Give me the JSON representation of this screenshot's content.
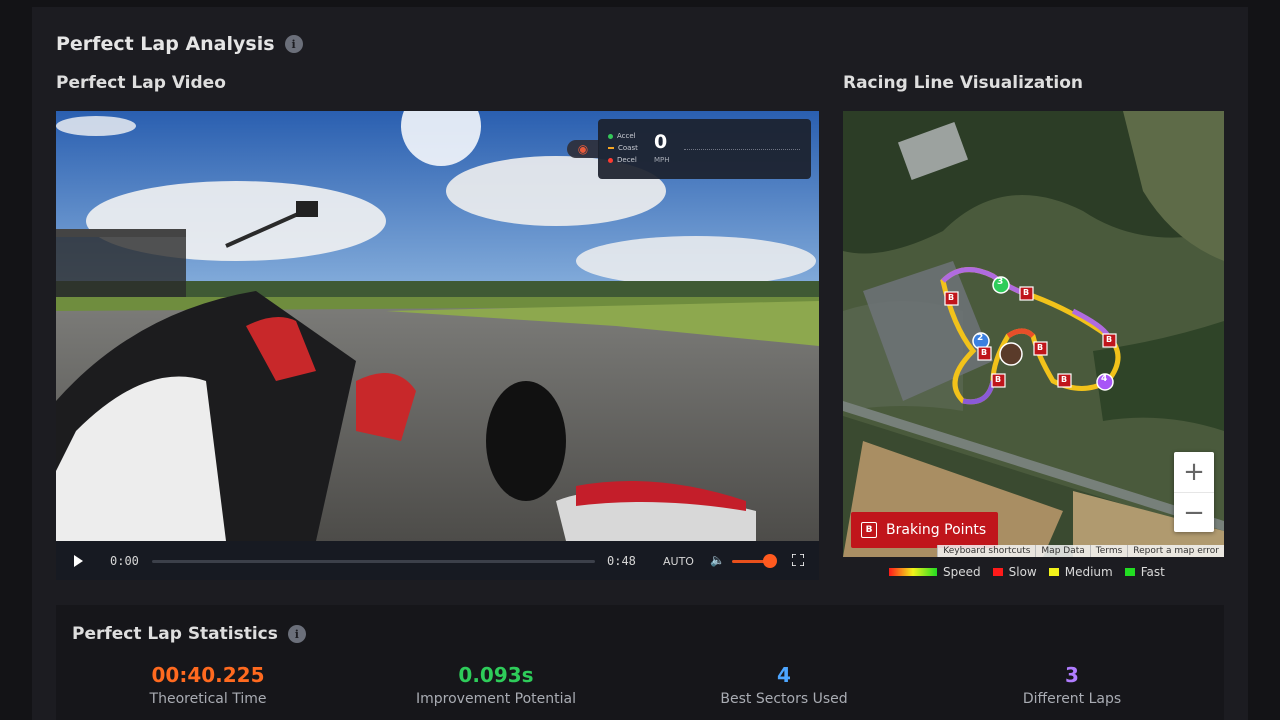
{
  "header": {
    "title": "Perfect Lap Analysis",
    "info_glyph": "i"
  },
  "video_section": {
    "title": "Perfect Lap Video",
    "overlay": {
      "legend": [
        {
          "label": "Accel",
          "color": "#34c759"
        },
        {
          "label": "Coast",
          "color": "#f5a623"
        },
        {
          "label": "Decel",
          "color": "#ff3b30"
        }
      ],
      "speed_value": "0",
      "speed_unit": "MPH"
    },
    "player": {
      "current_time": "0:00",
      "duration": "0:48",
      "quality": "AUTO",
      "progress": 0,
      "volume": 0.9
    }
  },
  "map_section": {
    "title": "Racing Line Visualization",
    "markers": [
      "1",
      "2",
      "3",
      "4"
    ],
    "brake_marker_label": "B",
    "braking_button": "Braking Points",
    "zoom_in": "+",
    "zoom_out": "−",
    "attribution": [
      "Keyboard shortcuts",
      "Map Data",
      "Terms",
      "Report a map error"
    ],
    "legend": [
      {
        "label": "Speed",
        "color": "gradient"
      },
      {
        "label": "Slow",
        "color": "#ff1a1a"
      },
      {
        "label": "Medium",
        "color": "#f2f21a"
      },
      {
        "label": "Fast",
        "color": "#22dd22"
      }
    ]
  },
  "stats": {
    "title": "Perfect Lap Statistics",
    "items": [
      {
        "value": "00:40.225",
        "label": "Theoretical Time",
        "color": "#ff6a1f"
      },
      {
        "value": "0.093s",
        "label": "Improvement Potential",
        "color": "#2ecc5a"
      },
      {
        "value": "4",
        "label": "Best Sectors Used",
        "color": "#4da6ff"
      },
      {
        "value": "3",
        "label": "Different Laps",
        "color": "#b07cff"
      }
    ]
  }
}
